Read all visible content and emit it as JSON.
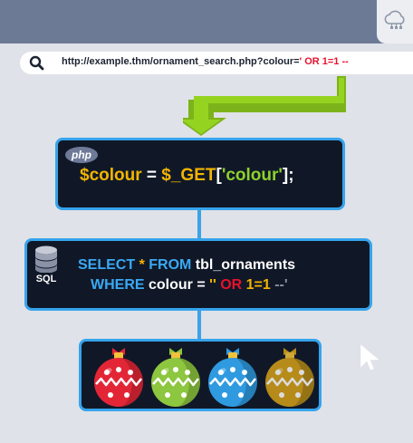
{
  "browser": {
    "url_base": "http://example.thm/ornament_search.php?colour=",
    "url_injection": "' OR 1=1 --",
    "icons": {
      "search": "search-icon",
      "cloud": "cloud-icon"
    }
  },
  "php": {
    "badge": "php",
    "var": "$colour",
    "eq": " = ",
    "get": "$_GET",
    "lbracket": "[",
    "key": "'colour'",
    "rbracket": "];"
  },
  "sql": {
    "label": "SQL",
    "select": "SELECT",
    "star": " * ",
    "from": "FROM",
    "table": " tbl_ornaments",
    "where": "WHERE",
    "column": " colour = ",
    "quotes": "''",
    "or": " OR ",
    "cond": "1=1",
    "comment": " --'"
  },
  "ornaments": {
    "colors": [
      "#e32636",
      "#8dc63f",
      "#2f9ae0",
      "#d4a017"
    ]
  },
  "colors": {
    "arrow": "#88c81c",
    "connector": "#3aa3e6",
    "box_border": "#36a4ec",
    "box_bg": "#101828"
  }
}
